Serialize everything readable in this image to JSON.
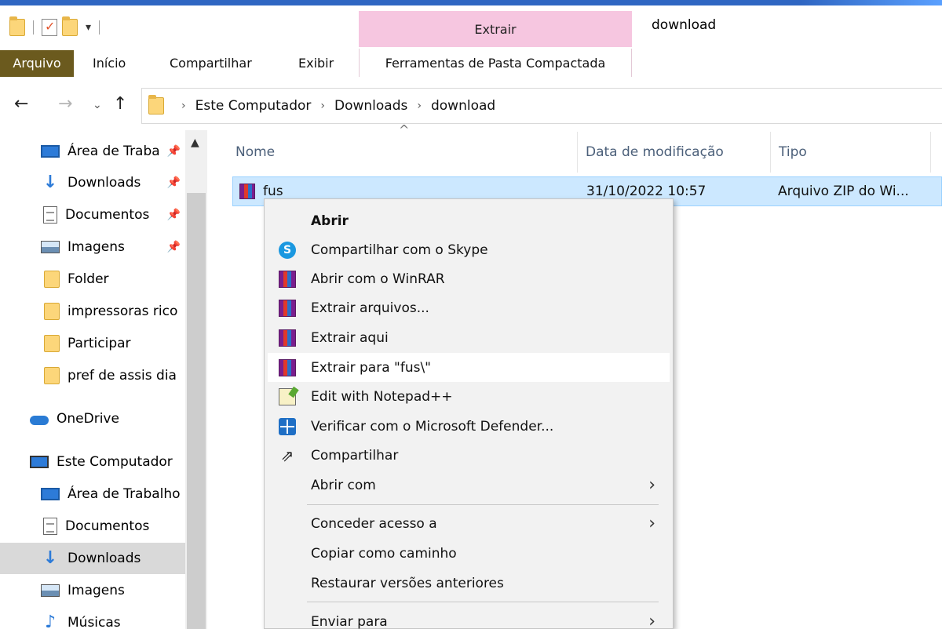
{
  "window": {
    "title": "download",
    "context_tab_header": "Extrair"
  },
  "ribbon": {
    "tabs": [
      "Arquivo",
      "Início",
      "Compartilhar",
      "Exibir"
    ],
    "context_tab": "Ferramentas de Pasta Compactada"
  },
  "address": {
    "crumbs": [
      "Este Computador",
      "Downloads",
      "download"
    ]
  },
  "sidebar": {
    "items": [
      {
        "label": "Área de Traba",
        "icon": "desktop-icon",
        "pinned": true
      },
      {
        "label": "Downloads",
        "icon": "download-icon",
        "pinned": true
      },
      {
        "label": "Documentos",
        "icon": "document-icon",
        "pinned": true
      },
      {
        "label": "Imagens",
        "icon": "pictures-icon",
        "pinned": true
      },
      {
        "label": "Folder",
        "icon": "folder-icon"
      },
      {
        "label": "impressoras rico",
        "icon": "folder-icon"
      },
      {
        "label": "Participar",
        "icon": "folder-icon"
      },
      {
        "label": "pref de assis dia",
        "icon": "folder-icon"
      },
      {
        "label": "OneDrive",
        "icon": "onedrive-icon"
      },
      {
        "label": "Este Computador",
        "icon": "computer-icon"
      },
      {
        "label": "Área de Trabalho",
        "icon": "desktop-icon"
      },
      {
        "label": "Documentos",
        "icon": "document-icon"
      },
      {
        "label": "Downloads",
        "icon": "download-icon",
        "selected": true
      },
      {
        "label": "Imagens",
        "icon": "pictures-icon"
      },
      {
        "label": "Músicas",
        "icon": "music-icon"
      }
    ]
  },
  "columns": {
    "name": "Nome",
    "date": "Data de modificação",
    "type": "Tipo"
  },
  "file": {
    "name": "fus",
    "date": "31/10/2022 10:57",
    "type": "Arquivo ZIP do Wi..."
  },
  "context_menu": {
    "items": [
      {
        "label": "Abrir",
        "bold": true
      },
      {
        "label": "Compartilhar com o Skype",
        "icon": "skype-icon"
      },
      {
        "label": "Abrir com o WinRAR",
        "icon": "winrar-icon"
      },
      {
        "label": "Extrair arquivos...",
        "icon": "winrar-icon"
      },
      {
        "label": "Extrair aqui",
        "icon": "winrar-icon"
      },
      {
        "label": "Extrair para \"fus\\\"",
        "icon": "winrar-icon",
        "hover": true
      },
      {
        "label": "Edit with Notepad++",
        "icon": "notepad-icon"
      },
      {
        "label": "Verificar com o Microsoft Defender...",
        "icon": "defender-icon"
      },
      {
        "label": "Compartilhar",
        "icon": "share-icon"
      },
      {
        "label": "Abrir com",
        "submenu": true
      },
      {
        "label": "Conceder acesso a",
        "submenu": true
      },
      {
        "label": "Copiar como caminho"
      },
      {
        "label": "Restaurar versões anteriores"
      },
      {
        "label": "Enviar para",
        "submenu": true
      }
    ]
  },
  "colors": {
    "file_tab": "#6b5a1e",
    "context_tab": "#f6c6e0",
    "selection": "#cce8ff",
    "accent": "#2f66c2"
  }
}
